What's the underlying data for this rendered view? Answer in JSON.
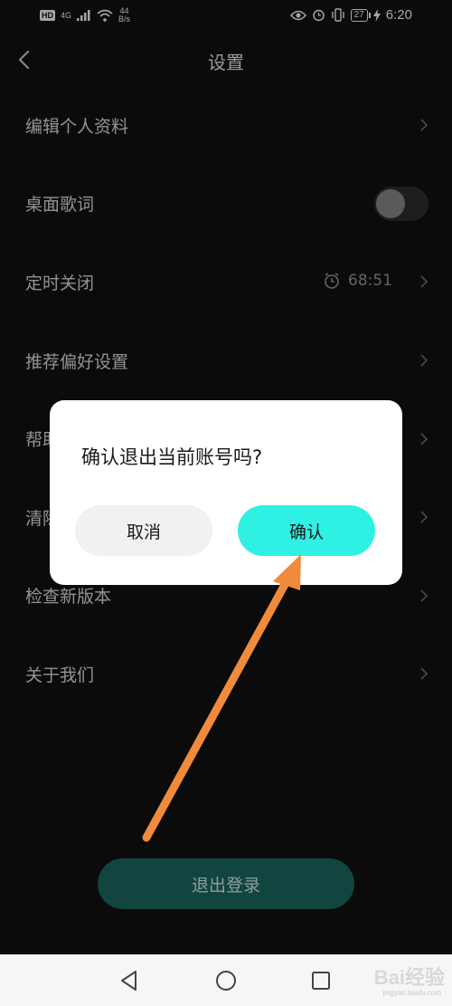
{
  "status_bar": {
    "hd": "HD",
    "network": "4G",
    "speed_value": "44",
    "speed_unit": "B/s",
    "battery": "27",
    "time": "6:20",
    "icons": [
      "signal-icon",
      "wifi-icon",
      "eye-icon",
      "alarm-icon",
      "vibrate-icon",
      "battery-icon",
      "charging-icon"
    ]
  },
  "header": {
    "title": "设置",
    "back_icon": "chevron-left-icon"
  },
  "settings": {
    "items": [
      {
        "label": "编辑个人资料"
      },
      {
        "label": "桌面歌词",
        "toggle_on": false
      },
      {
        "label": "定时关闭",
        "timer": "68:51"
      },
      {
        "label": "推荐偏好设置"
      },
      {
        "label": "帮助"
      },
      {
        "label": "清除缓存"
      },
      {
        "label": "检查新版本"
      },
      {
        "label": "关于我们"
      }
    ]
  },
  "logout": {
    "label": "退出登录"
  },
  "dialog": {
    "message": "确认退出当前账号吗?",
    "cancel_label": "取消",
    "confirm_label": "确认"
  },
  "annotation": {
    "color": "#f08a3c"
  },
  "navbar": {
    "icons": [
      "back-triangle-icon",
      "home-circle-icon",
      "recent-square-icon"
    ],
    "watermark": "Bai经验",
    "watermark_sub": "jingyan.baidu.com"
  },
  "colors": {
    "background": "#111112",
    "accent": "#2ff1e3",
    "logout": "#1d6b61"
  }
}
